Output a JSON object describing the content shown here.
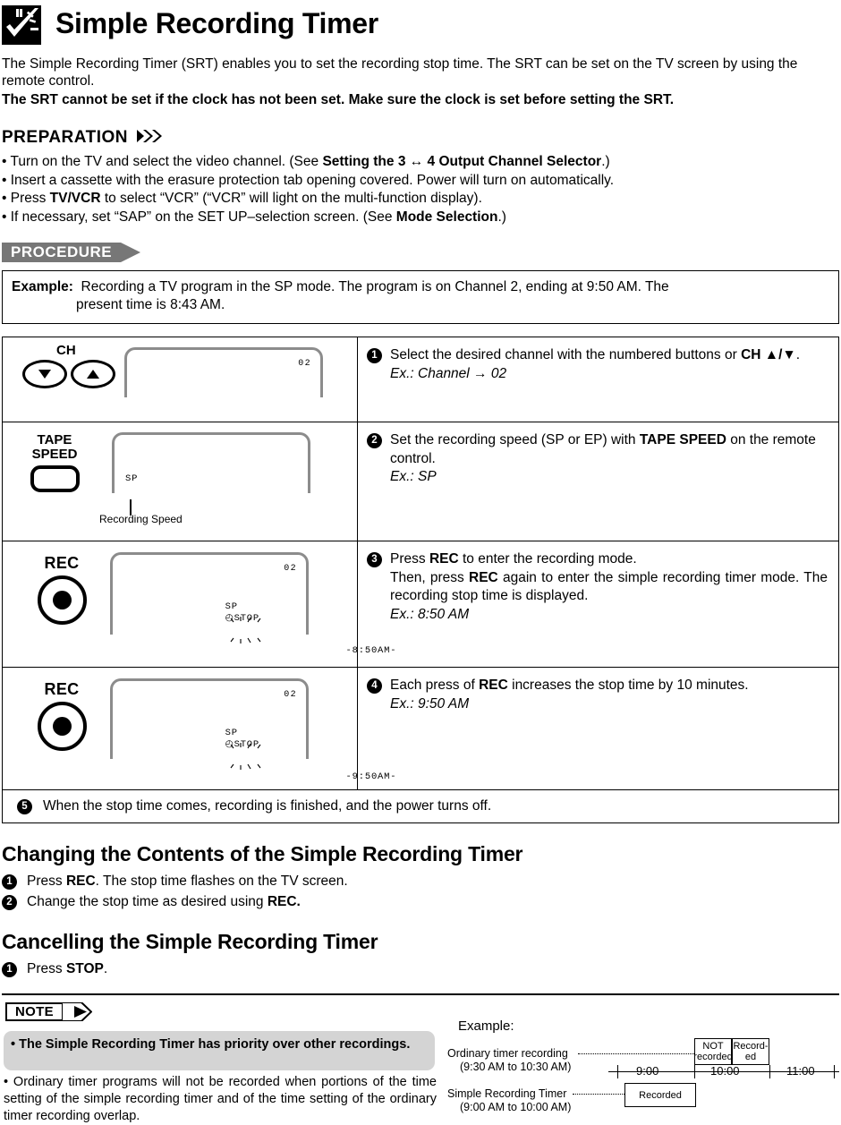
{
  "header": {
    "icon": "clock-timer-icon",
    "title": "Simple Recording Timer"
  },
  "intro": {
    "line1": "The Simple Recording Timer (SRT) enables you to set the recording stop time. The SRT can be set on the TV screen by using the remote control.",
    "line2": "The SRT cannot be set if the clock has not been set. Make sure the clock is set before setting the SRT."
  },
  "preparation": {
    "heading": "PREPARATION",
    "arrows": "❯❯❯",
    "bullets": [
      {
        "pre": "• Turn on the TV and select the video channel. (See ",
        "bold": "Setting the 3 ↔ 4 Output Channel Selector",
        "post": ".)"
      },
      {
        "pre": "• Insert a cassette with the erasure protection tab opening covered. Power will turn on automatically.",
        "bold": "",
        "post": ""
      },
      {
        "pre": "• Press ",
        "bold": "TV/VCR",
        "post": " to select “VCR” (“VCR” will light on the multi-function display)."
      },
      {
        "pre": "• If necessary, set “SAP” on the SET UP–selection screen. (See ",
        "bold": "Mode Selection",
        "post": ".)"
      }
    ]
  },
  "procedure": {
    "banner": "PROCEDURE",
    "example_label": "Example:",
    "example_line1": "Recording a TV program in the SP mode. The program is on Channel 2, ending at 9:50 AM. The",
    "example_line2": "present time is 8:43 AM.",
    "steps": [
      {
        "num": "❶",
        "control": "ch-updown",
        "ch_label": "CH",
        "display_channel": "02",
        "display_lcd": "",
        "text_pre": "Select the desired channel with the numbered buttons or ",
        "text_bold": "CH ▲/▼",
        "text_post": ".",
        "example": "Ex.: Channel → 02"
      },
      {
        "num": "❷",
        "control": "tape-speed",
        "tape_label_line1": "TAPE",
        "tape_label_line2": "SPEED",
        "display_channel": "",
        "display_lcd": "SP",
        "caption": "Recording Speed",
        "text_pre": "Set the recording speed (SP or EP) with ",
        "text_bold": "TAPE SPEED",
        "text_post": " on the remote control.",
        "example": "Ex.: SP"
      },
      {
        "num": "❸",
        "control": "rec",
        "rec_label": "REC",
        "display_channel": "02",
        "display_lcd": "SP ⏱STOP  -8:50AM-",
        "lcd_speed": "SP",
        "lcd_mode": "STOP",
        "lcd_time": "8:50AM",
        "text_pre": "Press ",
        "text_bold": "REC",
        "text_post": " to enter the recording mode.",
        "text_line2_pre": "Then, press ",
        "text_line2_bold": "REC",
        "text_line2_post": " again to enter the simple recording timer mode. The recording stop time is displayed.",
        "example": "Ex.: 8:50 AM"
      },
      {
        "num": "❹",
        "control": "rec",
        "rec_label": "REC",
        "display_channel": "02",
        "display_lcd": "SP ⏱STOP  -9:50AM-",
        "lcd_speed": "SP",
        "lcd_mode": "STOP",
        "lcd_time": "9:50AM",
        "text_pre": "Each press of ",
        "text_bold": "REC",
        "text_post": " increases the stop time by 10 minutes.",
        "example": "Ex.: 9:50 AM"
      }
    ],
    "step5_num": "❺",
    "step5_text": "When the stop time comes, recording is finished, and the power turns off."
  },
  "changing": {
    "heading": "Changing the Contents of the Simple Recording Timer",
    "items": [
      {
        "num": "❶",
        "pre": "Press ",
        "bold": "REC",
        "post": ". The stop time flashes on the TV screen."
      },
      {
        "num": "❷",
        "pre": "Change the stop time as desired using ",
        "bold": "REC.",
        "post": ""
      }
    ]
  },
  "cancelling": {
    "heading": "Cancelling the Simple Recording Timer",
    "items": [
      {
        "num": "❶",
        "pre": "Press ",
        "bold": "STOP",
        "post": "."
      }
    ]
  },
  "note": {
    "tag": "NOTE",
    "highlight": "• The Simple Recording Timer has priority over other recordings.",
    "plain": "• Ordinary timer programs will not be recorded when portions of the time setting of the simple recording timer and of the time setting of the ordinary timer recording overlap."
  },
  "diagram": {
    "title": "Example:",
    "ordinary_label_line1": "Ordinary timer recording",
    "ordinary_label_line2": "(9:30 AM to 10:30 AM)",
    "simple_label_line1": "Simple Recording Timer",
    "simple_label_line2": "(9:00 AM to 10:00 AM)",
    "box_not_recorded_line1": "NOT",
    "box_not_recorded_line2": "recorded",
    "box_recorded_line1": "Record-",
    "box_recorded_line2": "ed",
    "box_simple_recorded": "Recorded",
    "tick_labels": [
      "9:00",
      "10:00",
      "11:00"
    ]
  },
  "colors": {
    "banner_gray": "#777777",
    "note_highlight_gray": "#d4d4d4",
    "panel_outline_gray": "#8c8c8c",
    "ink": "#000000"
  }
}
